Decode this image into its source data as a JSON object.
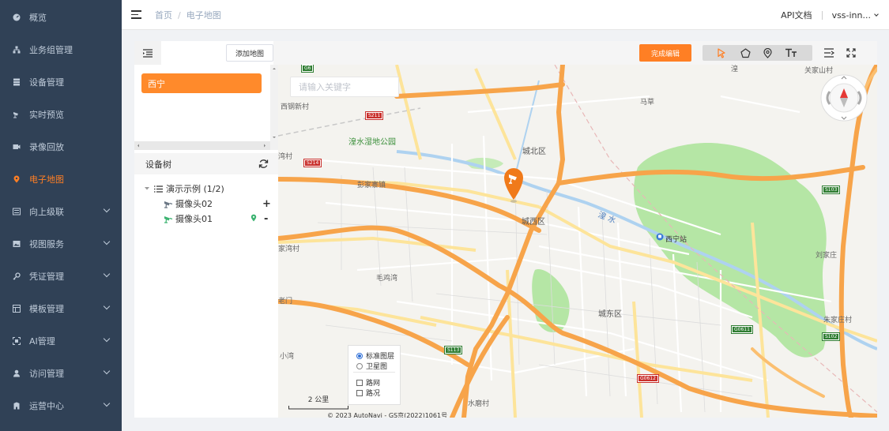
{
  "sidebar": {
    "items": [
      {
        "label": "概览",
        "icon": "dashboard-icon",
        "has_arrow": false
      },
      {
        "label": "业务组管理",
        "icon": "org-tree-icon",
        "has_arrow": false
      },
      {
        "label": "设备管理",
        "icon": "server-icon",
        "has_arrow": false
      },
      {
        "label": "实时预览",
        "icon": "camera-icon",
        "has_arrow": false
      },
      {
        "label": "录像回放",
        "icon": "video-icon",
        "has_arrow": false
      },
      {
        "label": "电子地图",
        "icon": "map-pin-icon",
        "has_arrow": false,
        "active": true
      },
      {
        "label": "向上级联",
        "icon": "cascade-icon",
        "has_arrow": true
      },
      {
        "label": "视图服务",
        "icon": "image-icon",
        "has_arrow": true
      },
      {
        "label": "凭证管理",
        "icon": "key-icon",
        "has_arrow": true
      },
      {
        "label": "模板管理",
        "icon": "template-icon",
        "has_arrow": true
      },
      {
        "label": "AI管理",
        "icon": "ai-scan-icon",
        "has_arrow": true
      },
      {
        "label": "访问管理",
        "icon": "user-icon",
        "has_arrow": true
      },
      {
        "label": "运营中心",
        "icon": "building-icon",
        "has_arrow": true
      }
    ]
  },
  "header": {
    "breadcrumb": [
      "首页",
      "电子地图"
    ],
    "breadcrumb_sep": "/",
    "api_docs": "API文档",
    "user": "vss-inn..."
  },
  "toolbar": {
    "add_map": "添加地图",
    "finish_edit": "完成编辑",
    "accent": "#ff7f24"
  },
  "maps": {
    "selected": "西宁"
  },
  "device_tree": {
    "title": "设备树",
    "group": "演示示例 (1/2)",
    "devices": [
      {
        "name": "摄像头02",
        "action": "+",
        "online": false
      },
      {
        "name": "摄像头01",
        "action": "-",
        "online": true
      }
    ]
  },
  "map": {
    "search_placeholder": "请输入关键字",
    "labels": {
      "xigang": "西钢新村",
      "mapo": "马草",
      "guanjia": "关家山村",
      "huang": "湟",
      "park": "湟水湿地公园",
      "chengbei": "城北区",
      "wan": "湾村",
      "pengjia": "彭家寨镇",
      "chengxi": "城西区",
      "huangshui": "湟 水",
      "xining_station": "西宁站",
      "liujia": "刘家庄",
      "haowan": "家湾村",
      "maojiawan": "毛鸡湾",
      "laomen": "老门",
      "chengdong": "城东区",
      "zhujia": "朱家庄村",
      "xiaowan": "小湾",
      "shuimo": "水磨村"
    },
    "shields": {
      "g6": "G6",
      "s211": "S211",
      "s214": "S214",
      "s103": "S103",
      "g0611": "G0611",
      "s102": "S102",
      "s113": "S113",
      "g0612": "G0612"
    },
    "layers": {
      "standard": "标准图层",
      "satellite": "卫星图",
      "roadnet": "路网",
      "traffic": "路况",
      "selected": "standard"
    },
    "scale": "2 公里",
    "copyright": "© 2023 AutoNavi - GS京(2022)1061号"
  }
}
